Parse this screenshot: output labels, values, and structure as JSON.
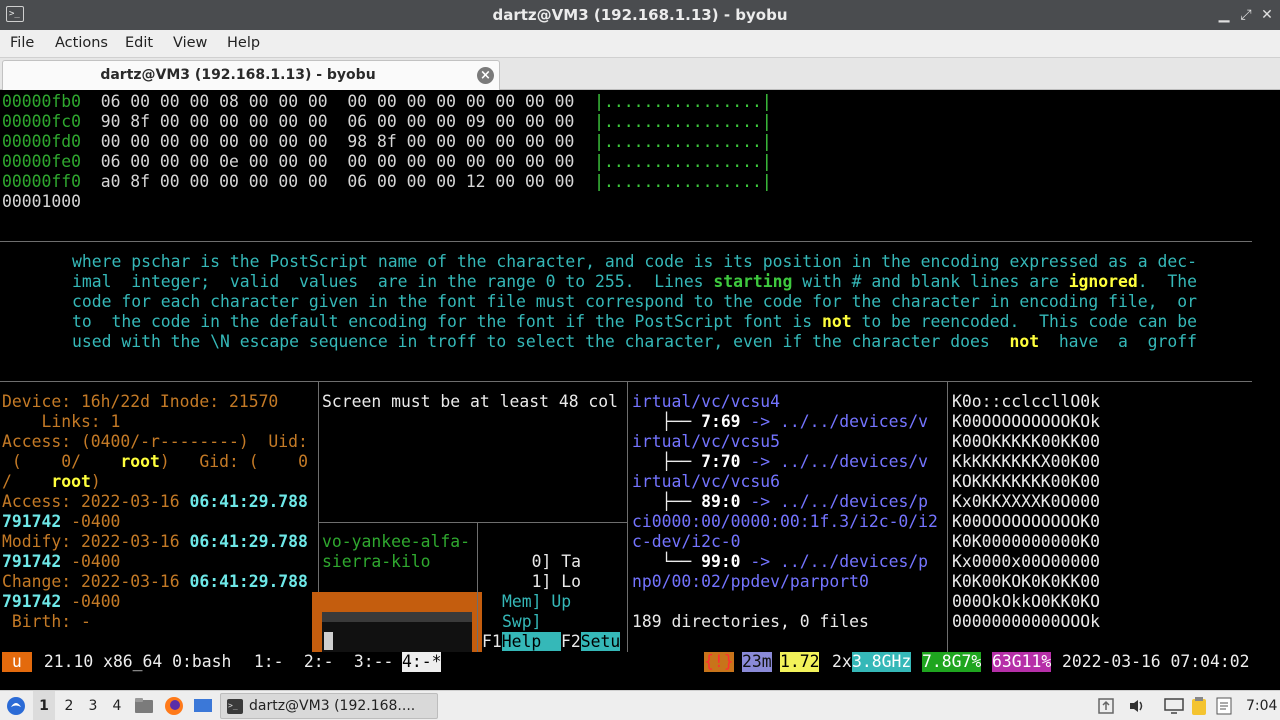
{
  "window": {
    "title": "dartz@VM3 (192.168.1.13) - byobu",
    "controls": [
      "▁",
      "⤢",
      "✕"
    ]
  },
  "menu": [
    "File",
    "Actions",
    "Edit",
    "View",
    "Help"
  ],
  "tab": {
    "title": "dartz@VM3 (192.168.1.13) - byobu",
    "close_glyph": "×"
  },
  "hexdump": {
    "rows": [
      {
        "addr": "00000fb0",
        "bytes": "06 00 00 00 08 00 00 00  00 00 00 00 00 00 00 00",
        "ascii": "|................|"
      },
      {
        "addr": "00000fc0",
        "bytes": "90 8f 00 00 00 00 00 00  06 00 00 00 09 00 00 00",
        "ascii": "|................|"
      },
      {
        "addr": "00000fd0",
        "bytes": "00 00 00 00 00 00 00 00  98 8f 00 00 00 00 00 00",
        "ascii": "|................|"
      },
      {
        "addr": "00000fe0",
        "bytes": "06 00 00 00 0e 00 00 00  00 00 00 00 00 00 00 00",
        "ascii": "|................|"
      },
      {
        "addr": "00000ff0",
        "bytes": "a0 8f 00 00 00 00 00 00  06 00 00 00 12 00 00 00",
        "ascii": "|................|"
      }
    ],
    "end": "00001000"
  },
  "manpage": {
    "lines": [
      "where pschar is the PostScript name of the character, and code is its position in the encoding expressed as a dec-",
      "imal  integer;  valid  values  are in the range 0 to 255.  Lines ",
      "code for each character given in the font file must correspond to the code for the character in encoding file,  or",
      "to  the code in the default encoding for the font if the PostScript font is ",
      "used with the \\N escape sequence in troff to select the character, even if the character does  "
    ],
    "line2_bold1": "starting",
    "line2_mid": " with # and blank lines are ",
    "line2_bold2": "ignored",
    "line2_end": ".  The",
    "line4_bold": "not",
    "line4_end": " to be reencoded.  This code can be",
    "line5_bold": "not",
    "line5_end": "  have  a  groff"
  },
  "stat": {
    "device_line": "Device: 16h/22d Inode: 21570",
    "links_line": "    Links: 1",
    "access_perm": "Access: (0400/-r--------)  Uid:",
    "uid_open": " (    0/",
    "uid_user": "root",
    "gid_label": ")   Gid: (    0",
    "gid_open": "/",
    "gid_user": "root",
    "gid_close": ")",
    "access_label": "Access: 2022-03-16 ",
    "access_time": "06:41:29.788",
    "access_frac": "791742",
    "tz": " -0400",
    "modify_label": "Modify: 2022-03-16 ",
    "modify_time": "06:41:29.788",
    "modify_frac": "791742",
    "change_label": "Change: 2022-03-16 ",
    "change_time": "06:41:29.788",
    "change_frac": "791742",
    "birth_line": " Birth: -"
  },
  "screen_warning": "Screen must be at least 48 col",
  "hostname_pane": [
    "vo-yankee-alfa-",
    "sierra-kilo"
  ],
  "htop": {
    "rows": [
      "   0] Ta",
      "   1] Lo",
      "Mem] Up",
      "Swp]"
    ],
    "f1_key": "F1",
    "f1_label": "Help  ",
    "f2_key": "F2",
    "f2_label": "Setu"
  },
  "tree": {
    "l1": "irtual/vc/vcsu4",
    "l2_pre": "   ├── ",
    "l2_num": "7:69",
    "l2_arrow": " -> ../../devices/v",
    "l3": "irtual/vc/vcsu5",
    "l4_pre": "   ├── ",
    "l4_num": "7:70",
    "l4_arrow": " -> ../../devices/v",
    "l5": "irtual/vc/vcsu6",
    "l6_pre": "   ├── ",
    "l6_num": "89:0",
    "l6_arrow": " -> ../../devices/p",
    "l7": "ci0000:00/0000:00:1f.3/i2c-0/i2",
    "l8": "c-dev/i2c-0",
    "l9_pre": "   └── ",
    "l9_num": "99:0",
    "l9_arrow": " -> ../../devices/p",
    "l10": "np0/00:02/ppdev/parport0",
    "summary": "189 directories, 0 files"
  },
  "art": [
    "K0o::cclccllO0k",
    "K00OOOOOOOOOKOk",
    "K00OKKKKK00KK00",
    "KkKKKKKKKX00K00",
    "KOKKKKKKKK00K00",
    "Kx0KKXXXXK0O000",
    "K00OOOOOOOOOOK0",
    "K0K0000000000K0",
    "Kx0000x00O00000",
    "K0K00KOK0K0KK00",
    "000OkOkkO0KK0KO",
    "00000000000OOOk"
  ],
  "status": {
    "u": " u ",
    "release": " 21.10 x86_64 0:bash ",
    "win1": " 1:- ",
    "win2": " 2:- ",
    "win3": " 3:-- ",
    "win4": "4:-*",
    "alert": "{!}",
    "uptime": "23m",
    "load": "1.72",
    "cpu_count": "2x",
    "cpu_freq": "3.8GHz",
    "mem": "7.8G7%",
    "disk": "63G11%",
    "datetime": "2022-03-16 07:04:02"
  },
  "taskbar": {
    "workspaces": [
      "1",
      "2",
      "3",
      "4"
    ],
    "task_label": "dartz@VM3 (192.168....",
    "clock": "7:04"
  }
}
